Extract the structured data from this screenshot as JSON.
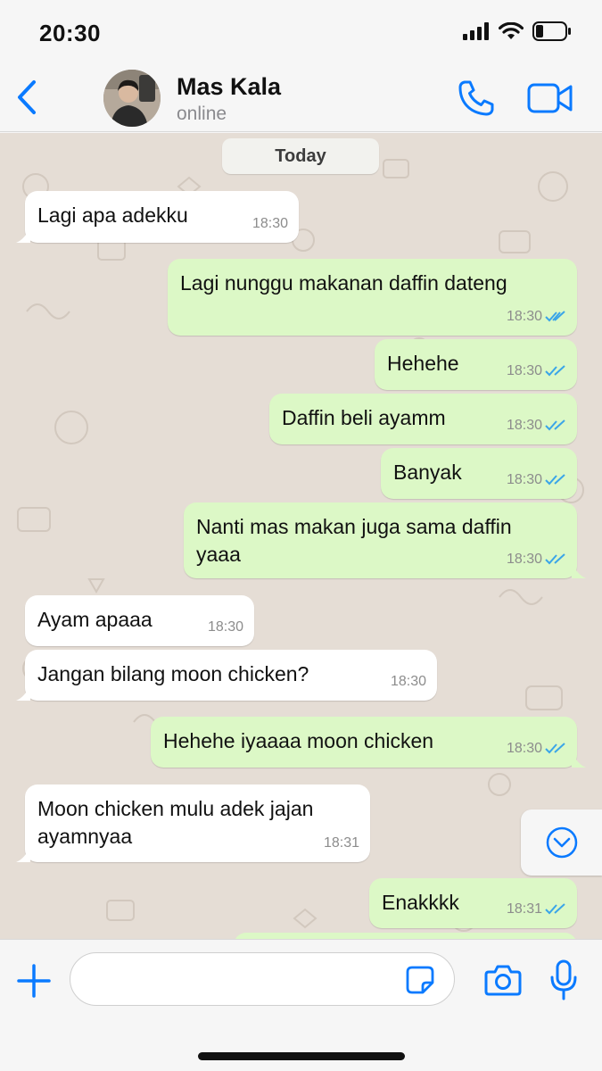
{
  "status_bar": {
    "time": "20:30"
  },
  "header": {
    "contact_name": "Mas Kala",
    "contact_status": "online"
  },
  "chat": {
    "date_label": "Today",
    "messages": [
      {
        "direction": "in",
        "text": "Lagi apa adekku",
        "time": "18:30"
      },
      {
        "direction": "out",
        "text": "Lagi nunggu makanan daffin dateng",
        "time": "18:30",
        "read": true
      },
      {
        "direction": "out",
        "text": "Hehehe",
        "time": "18:30",
        "read": true
      },
      {
        "direction": "out",
        "text": "Daffin beli ayamm",
        "time": "18:30",
        "read": true
      },
      {
        "direction": "out",
        "text": "Banyak",
        "time": "18:30",
        "read": true
      },
      {
        "direction": "out",
        "text": "Nanti mas makan juga sama daffin\nyaaa",
        "time": "18:30",
        "read": true
      },
      {
        "direction": "in",
        "text": "Ayam apaaa",
        "time": "18:30"
      },
      {
        "direction": "in",
        "text": "Jangan bilang moon chicken?",
        "time": "18:30"
      },
      {
        "direction": "out",
        "text": "Hehehe iyaaaa moon chicken",
        "time": "18:30",
        "read": true
      },
      {
        "direction": "in",
        "text": "Moon chicken mulu adek jajan\nayamnyaa",
        "time": "18:31"
      },
      {
        "direction": "out",
        "text": "Enakkkk",
        "time": "18:31",
        "read": true
      },
      {
        "direction": "out",
        "text": "",
        "time": ""
      }
    ]
  },
  "input_bar": {
    "placeholder": ""
  },
  "colors": {
    "accent": "#0a7aff",
    "outgoing_bubble": "#dcf8c6",
    "incoming_bubble": "#ffffff",
    "chat_background": "#e5ddd5",
    "read_ticks": "#3aa5e8"
  },
  "icons": [
    "back-chevron-icon",
    "call-icon",
    "video-call-icon",
    "scroll-down-icon",
    "plus-icon",
    "sticker-icon",
    "camera-icon",
    "microphone-icon",
    "signal-icon",
    "wifi-icon",
    "battery-icon"
  ]
}
